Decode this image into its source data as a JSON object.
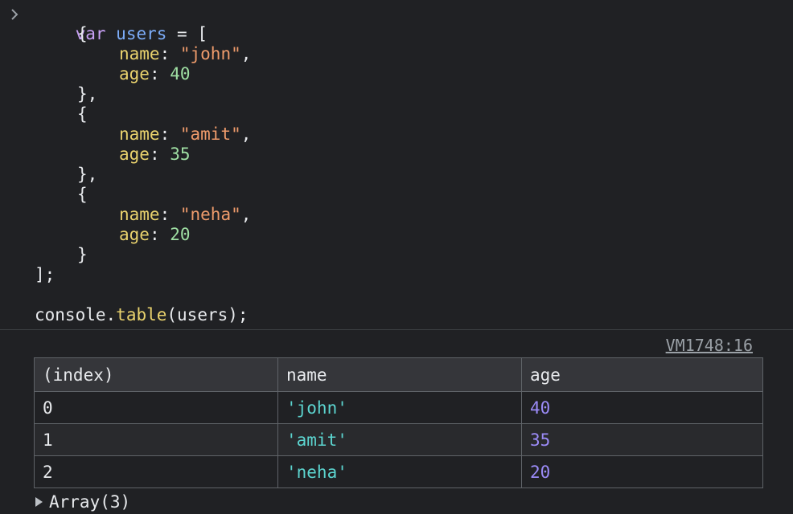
{
  "code": {
    "l1": {
      "kw": "var",
      "var": "users",
      "rest": " = ["
    },
    "l2": "{",
    "l3": {
      "prop": "name",
      "colon": ": ",
      "str": "\"john\"",
      "end": ","
    },
    "l4": {
      "prop": "age",
      "colon": ": ",
      "num": "40"
    },
    "l5": "},",
    "l6": "{",
    "l7": {
      "prop": "name",
      "colon": ": ",
      "str": "\"amit\"",
      "end": ","
    },
    "l8": {
      "prop": "age",
      "colon": ": ",
      "num": "35"
    },
    "l9": "},",
    "l10": "{",
    "l11": {
      "prop": "name",
      "colon": ": ",
      "str": "\"neha\"",
      "end": ","
    },
    "l12": {
      "prop": "age",
      "colon": ": ",
      "num": "20"
    },
    "l13": "}",
    "l14": "];",
    "l16": {
      "obj": "console",
      "dot": ".",
      "fn": "table",
      "args": "(users);"
    }
  },
  "source_link": "VM1748:16",
  "table": {
    "headers": [
      "(index)",
      "name",
      "age"
    ],
    "rows": [
      {
        "index": "0",
        "name": "'john'",
        "age": "40"
      },
      {
        "index": "1",
        "name": "'amit'",
        "age": "35"
      },
      {
        "index": "2",
        "name": "'neha'",
        "age": "20"
      }
    ]
  },
  "array_label": "Array(3)",
  "colors": {
    "keyword": "#c8a0f5",
    "variable": "#7cacf8",
    "string": "#ee9b6b",
    "number": "#9fdfa3",
    "table_string": "#5cd5d0",
    "table_number": "#9b8bf7"
  }
}
